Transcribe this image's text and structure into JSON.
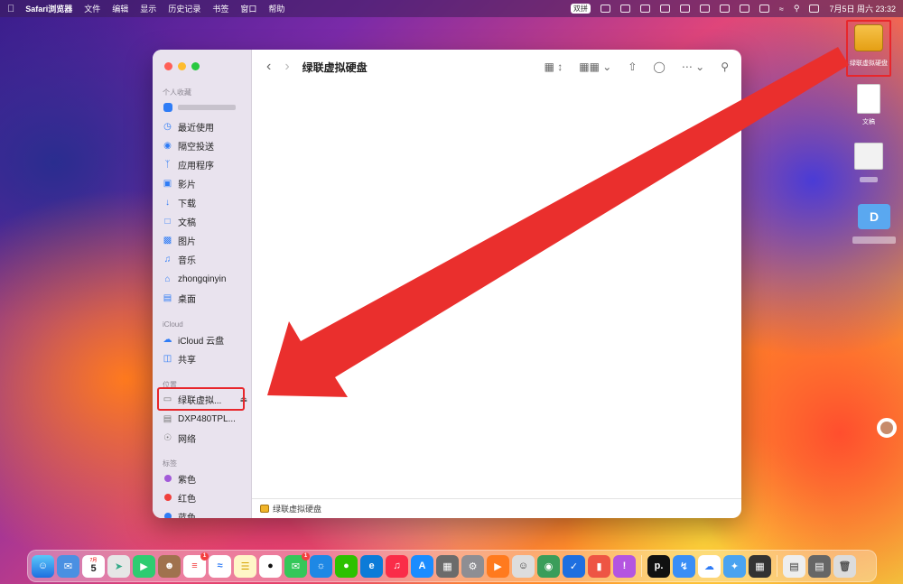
{
  "menubar": {
    "apple": "",
    "app_name": "Safari浏览器",
    "menus": [
      "文件",
      "编辑",
      "显示",
      "历史记录",
      "书签",
      "窗口",
      "帮助"
    ],
    "badge": "双拼",
    "datetime": "7月5日 周六  23:32"
  },
  "window": {
    "title": "绿联虚拟硬盘",
    "status_label": "绿联虚拟硬盘",
    "traffic_colors": [
      "#ff5f57",
      "#febc2e",
      "#28c840"
    ]
  },
  "sidebar": {
    "favorites_title": "个人收藏",
    "favorites": [
      {
        "label": "",
        "icon": "app-icon"
      },
      {
        "label": "最近使用",
        "icon": "clock-icon"
      },
      {
        "label": "隔空投送",
        "icon": "airdrop-icon"
      },
      {
        "label": "应用程序",
        "icon": "apps-icon"
      },
      {
        "label": "影片",
        "icon": "film-icon"
      },
      {
        "label": "下载",
        "icon": "download-icon"
      },
      {
        "label": "文稿",
        "icon": "document-icon"
      },
      {
        "label": "图片",
        "icon": "photo-icon"
      },
      {
        "label": "音乐",
        "icon": "music-icon"
      },
      {
        "label": "zhongqinyin",
        "icon": "home-icon"
      },
      {
        "label": "桌面",
        "icon": "desktop-icon"
      }
    ],
    "icloud_title": "iCloud",
    "icloud": [
      {
        "label": "iCloud 云盘",
        "icon": "cloud-icon"
      },
      {
        "label": "共享",
        "icon": "shared-icon"
      }
    ],
    "locations_title": "位置",
    "locations": [
      {
        "label": "绿联虚拟...",
        "icon": "drive-icon"
      },
      {
        "label": "DXP480TPL...",
        "icon": "display-icon"
      },
      {
        "label": "网络",
        "icon": "network-icon"
      }
    ],
    "tags_title": "标签",
    "tags": [
      {
        "label": "紫色",
        "color": "#a259d9"
      },
      {
        "label": "红色",
        "color": "#f0403c"
      },
      {
        "label": "蓝色",
        "color": "#2f7cf6"
      }
    ]
  },
  "desktop": {
    "icons": [
      {
        "label": "绿联虚拟硬盘"
      },
      {
        "label": "文稿"
      },
      {
        "label": ""
      },
      {
        "label": ""
      }
    ]
  },
  "dock": {
    "calendar_month": "7月",
    "calendar_day": "5",
    "badge_count": "1"
  },
  "colors": {
    "accent": "#2f7cf6",
    "highlight": "#e8262b"
  }
}
